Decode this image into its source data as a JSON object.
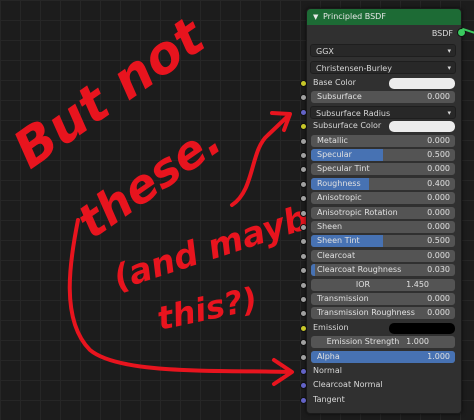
{
  "node": {
    "title": "Principled BSDF",
    "output_label": "BSDF",
    "distribution": "GGX",
    "subsurface_method": "Christensen-Burley",
    "inputs": [
      {
        "type": "color",
        "label": "Base Color",
        "swatch": "#ececec"
      },
      {
        "type": "value",
        "label": "Subsurface",
        "value": "0.000",
        "fill": 0
      },
      {
        "type": "vector",
        "label": "Subsurface Radius"
      },
      {
        "type": "color",
        "label": "Subsurface Color",
        "swatch": "#ececec"
      },
      {
        "type": "value",
        "label": "Metallic",
        "value": "0.000",
        "fill": 0
      },
      {
        "type": "value",
        "label": "Specular",
        "value": "0.500",
        "fill": 0.5
      },
      {
        "type": "value",
        "label": "Specular Tint",
        "value": "0.000",
        "fill": 0
      },
      {
        "type": "value",
        "label": "Roughness",
        "value": "0.400",
        "fill": 0.4
      },
      {
        "type": "value",
        "label": "Anisotropic",
        "value": "0.000",
        "fill": 0
      },
      {
        "type": "value",
        "label": "Anisotropic Rotation",
        "value": "0.000",
        "fill": 0
      },
      {
        "type": "value",
        "label": "Sheen",
        "value": "0.000",
        "fill": 0
      },
      {
        "type": "value",
        "label": "Sheen Tint",
        "value": "0.500",
        "fill": 0.5
      },
      {
        "type": "value",
        "label": "Clearcoat",
        "value": "0.000",
        "fill": 0
      },
      {
        "type": "value",
        "label": "Clearcoat Roughness",
        "value": "0.030",
        "fill": 0.03
      },
      {
        "type": "value",
        "label": "IOR",
        "value": "1.450",
        "fill": 0,
        "centered": true
      },
      {
        "type": "value",
        "label": "Transmission",
        "value": "0.000",
        "fill": 0
      },
      {
        "type": "value",
        "label": "Transmission Roughness",
        "value": "0.000",
        "fill": 0
      },
      {
        "type": "color",
        "label": "Emission",
        "swatch": "#000000"
      },
      {
        "type": "value",
        "label": "Emission Strength",
        "value": "1.000",
        "fill": 0,
        "centered": true
      },
      {
        "type": "value",
        "label": "Alpha",
        "value": "1.000",
        "fill": 1
      },
      {
        "type": "vector",
        "label": "Normal"
      },
      {
        "type": "vector",
        "label": "Clearcoat Normal"
      },
      {
        "type": "vector",
        "label": "Tangent"
      }
    ]
  },
  "annotation": {
    "line1": "But not",
    "line2": "these.",
    "line3": "(and maybe",
    "line4": "this?)",
    "color": "#e8141e"
  }
}
